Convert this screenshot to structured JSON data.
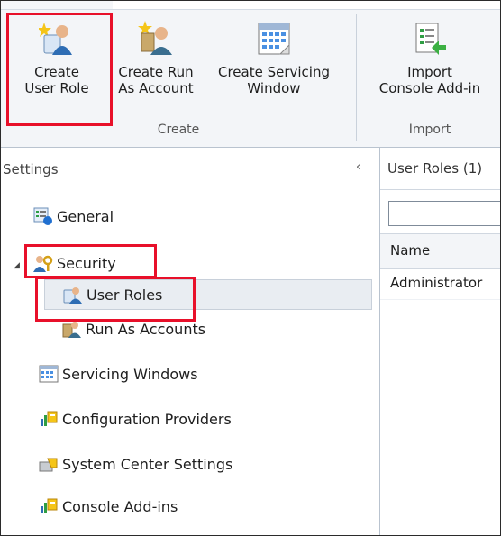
{
  "ribbon": {
    "buttons": [
      {
        "line1": "Create",
        "line2": "User Role",
        "icon": "create-user-role-icon"
      },
      {
        "line1": "Create Run",
        "line2": "As Account",
        "icon": "create-run-as-account-icon"
      },
      {
        "line1": "Create Servicing",
        "line2": "Window",
        "icon": "servicing-window-icon"
      },
      {
        "line1": "Import",
        "line2": "Console Add-in",
        "icon": "import-addin-icon"
      }
    ],
    "groups": {
      "create": "Create",
      "import": "Import"
    }
  },
  "nav": {
    "title": "Settings",
    "collapse_glyph": "‹",
    "items": [
      {
        "label": "General",
        "icon": "general-icon"
      },
      {
        "label": "Security",
        "icon": "security-keys-icon"
      },
      {
        "label": "User Roles",
        "icon": "user-roles-icon"
      },
      {
        "label": "Run As Accounts",
        "icon": "run-as-accounts-icon"
      },
      {
        "label": "Servicing Windows",
        "icon": "calendar-icon"
      },
      {
        "label": "Configuration Providers",
        "icon": "config-providers-icon"
      },
      {
        "label": "System Center Settings",
        "icon": "system-center-icon"
      },
      {
        "label": "Console Add-ins",
        "icon": "console-addins-icon"
      }
    ]
  },
  "pane": {
    "title": "User Roles (1)",
    "search_value": "",
    "columns": [
      "Name"
    ],
    "rows": [
      [
        "Administrator"
      ]
    ]
  },
  "colors": {
    "highlight": "#e8102a",
    "ribbon_bg": "#f3f5f8",
    "selected_bg": "#e9edf2"
  }
}
